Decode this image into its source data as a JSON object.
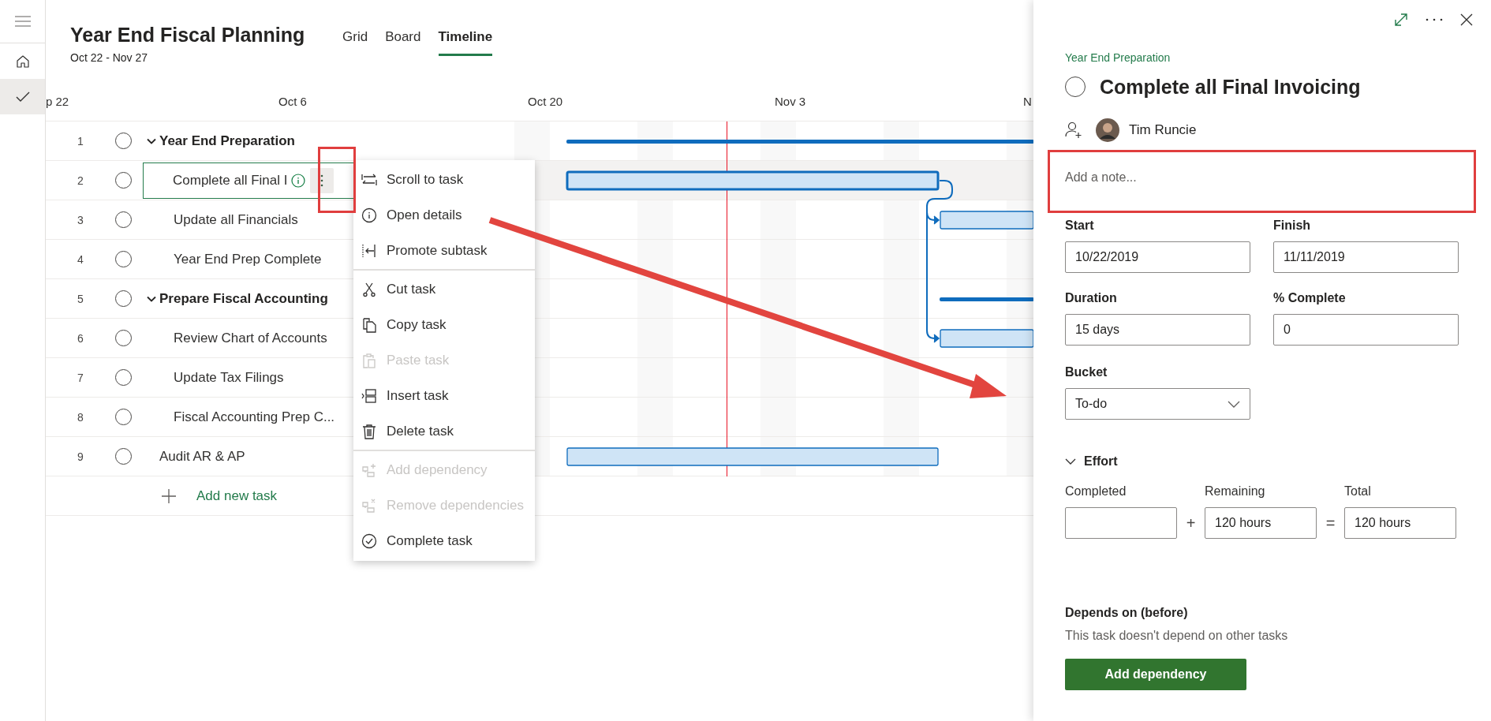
{
  "rail": {
    "items": [
      {
        "kind": "home",
        "selected": false
      },
      {
        "kind": "tasks",
        "selected": true
      }
    ]
  },
  "header": {
    "title": "Year End Fiscal Planning",
    "date_range": "Oct 22 - Nov 27"
  },
  "tabs": [
    {
      "label": "Grid",
      "selected": false
    },
    {
      "label": "Board",
      "selected": false
    },
    {
      "label": "Timeline",
      "selected": true
    }
  ],
  "timeline": {
    "date_labels": [
      "p 22",
      "Oct 6",
      "Oct 20",
      "Nov 3",
      "N"
    ]
  },
  "tasks": [
    {
      "number": "1",
      "title": "Year End Preparation",
      "completed": false,
      "expanded": true,
      "selected": false,
      "children": [
        {
          "number": "2",
          "title": "Complete all Final I",
          "completed": false,
          "selected": true
        },
        {
          "number": "3",
          "title": "Update all Financials",
          "completed": false,
          "selected": false
        },
        {
          "number": "4",
          "title": "Year End Prep Complete",
          "completed": false,
          "selected": false
        }
      ]
    },
    {
      "number": "5",
      "title": "Prepare Fiscal Accounting",
      "completed": false,
      "expanded": true,
      "selected": false,
      "children": [
        {
          "number": "6",
          "title": "Review Chart of Accounts",
          "completed": false,
          "selected": false
        },
        {
          "number": "7",
          "title": "Update Tax Filings",
          "completed": false,
          "selected": false
        },
        {
          "number": "8",
          "title": "Fiscal Accounting Prep C...",
          "completed": false,
          "selected": false
        }
      ]
    },
    {
      "number": "9",
      "title": "Audit AR & AP",
      "completed": false,
      "selected": false
    }
  ],
  "add_task": {
    "label": "Add new task"
  },
  "context_menu": {
    "groups": [
      [
        {
          "label": "Scroll to task",
          "kind": "scroll",
          "disabled": false
        },
        {
          "label": "Open details",
          "kind": "info",
          "disabled": false
        },
        {
          "label": "Promote subtask",
          "kind": "promote",
          "disabled": false
        }
      ],
      [
        {
          "label": "Cut task",
          "kind": "cut",
          "disabled": false
        },
        {
          "label": "Copy task",
          "kind": "copy",
          "disabled": false
        },
        {
          "label": "Paste task",
          "kind": "paste",
          "disabled": true
        },
        {
          "label": "Insert task",
          "kind": "insert",
          "disabled": false
        },
        {
          "label": "Delete task",
          "kind": "delete",
          "disabled": false
        }
      ],
      [
        {
          "label": "Add dependency",
          "kind": "add-dependency",
          "disabled": true
        },
        {
          "label": "Remove dependencies",
          "kind": "remove-dependency",
          "disabled": true
        },
        {
          "label": "Complete task",
          "kind": "complete",
          "disabled": false
        }
      ]
    ]
  },
  "details": {
    "bucket": "Year End Preparation",
    "title": "Complete all Final Invoicing",
    "completed": false,
    "assignee": "Tim Runcie",
    "note": {
      "placeholder": "Add a note..."
    },
    "start": {
      "label": "Start",
      "value": "10/22/2019"
    },
    "finish": {
      "label": "Finish",
      "value": "11/11/2019"
    },
    "duration": {
      "label": "Duration",
      "value": "15 days"
    },
    "percent_complete": {
      "label": "% Complete",
      "value": "0"
    },
    "bucket_field": {
      "label": "Bucket",
      "value": "To-do"
    },
    "effort": {
      "label": "Effort",
      "expanded": true,
      "plus": "+",
      "equals": "=",
      "completed": {
        "label": "Completed"
      },
      "remaining": {
        "label": "Remaining",
        "value": "120 hours"
      },
      "total": {
        "label": "Total",
        "value": "120 hours"
      }
    },
    "dependencies": {
      "heading": "Depends on (before)",
      "empty_text": "This task doesn't depend on other tasks",
      "button": "Add dependency"
    }
  }
}
